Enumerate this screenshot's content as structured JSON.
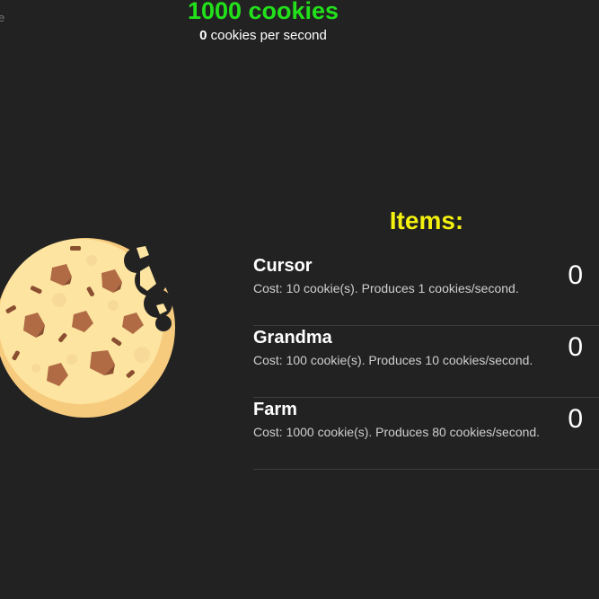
{
  "edge_text": "e",
  "header": {
    "cookies_label": "1000 cookies",
    "cps_value": "0",
    "cps_label": "cookies per second"
  },
  "cookie": {
    "icon": "cookie-icon",
    "colors": {
      "dough": "#fde4a0",
      "dough_shade": "#f7cb7e",
      "chip": "#b06b45",
      "chip_dark": "#8a4e30"
    }
  },
  "items_title": "Items:",
  "items": [
    {
      "name": "Cursor",
      "desc": "Cost: 10 cookie(s). Produces 1 cookies/second.",
      "count": "0"
    },
    {
      "name": "Grandma",
      "desc": "Cost: 100 cookie(s). Produces 10 cookies/second.",
      "count": "0"
    },
    {
      "name": "Farm",
      "desc": "Cost: 1000 cookie(s). Produces 80 cookies/second.",
      "count": "0"
    }
  ],
  "colors": {
    "background": "#222222",
    "cookie_count": "#22e11b",
    "items_title": "#f4f10e"
  }
}
